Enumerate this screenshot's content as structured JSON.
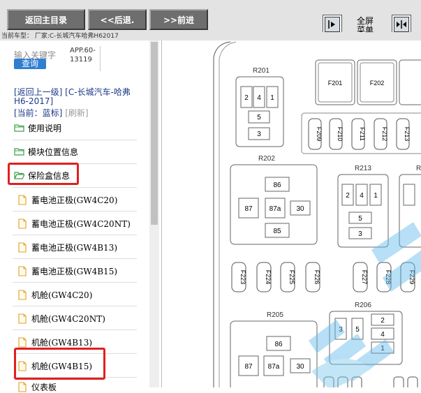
{
  "toolbar": {
    "main_menu": "返回主目录",
    "back": "<<后退.",
    "forward": ">>前进",
    "fullscreen_line1": "全屏",
    "fullscreen_line2": "菜单"
  },
  "car_model_line": "当前车型：   厂家:C-长城汽车哈弗H62017",
  "search": {
    "placeholder": "输入关键字",
    "button": "查询",
    "code_line1": "APP.60-",
    "code_line2": "13119"
  },
  "nav": {
    "back_link_line1": "[返回上一级]  [C-长城汽车-哈弗",
    "back_link_line2": "H6-2017]",
    "current": "[当前：蓝标]",
    "refresh": "[刷新]"
  },
  "folders": [
    {
      "label": "使用说明"
    },
    {
      "label": "模块位置信息"
    },
    {
      "label": "保险盒信息"
    }
  ],
  "files": [
    {
      "label": "蓄电池正极(GW4C20)"
    },
    {
      "label": "蓄电池正极(GW4C20NT)"
    },
    {
      "label": "蓄电池正极(GW4B13)"
    },
    {
      "label": "蓄电池正极(GW4B15)"
    },
    {
      "label": "机舱(GW4C20)"
    },
    {
      "label": "机舱(GW4C20NT)"
    },
    {
      "label": "机舱(GW4B13)"
    },
    {
      "label": "机舱(GW4B15)"
    },
    {
      "label": "仪表板"
    }
  ],
  "diagram": {
    "relay_blocks": [
      "R201",
      "R202",
      "R213",
      "R205",
      "R206"
    ],
    "r201_cells": [
      "2",
      "4",
      "1",
      "5",
      "3"
    ],
    "r202_cells": [
      "86",
      "87",
      "87a",
      "30",
      "85"
    ],
    "r213_cells": [
      "2",
      "4",
      "1",
      "5",
      "3"
    ],
    "r205_cells": [
      "86",
      "87",
      "87a",
      "30"
    ],
    "r206_cells": [
      "3",
      "5",
      "2",
      "4",
      "1"
    ],
    "top_fuses": [
      "F201",
      "F202"
    ],
    "vertical_fuses": [
      "F209",
      "F210",
      "F211",
      "F212",
      "F213"
    ],
    "middle_fuses": [
      "F223",
      "F224",
      "F225",
      "F226",
      "F227",
      "F228",
      "F229"
    ],
    "right_partial": "R"
  }
}
